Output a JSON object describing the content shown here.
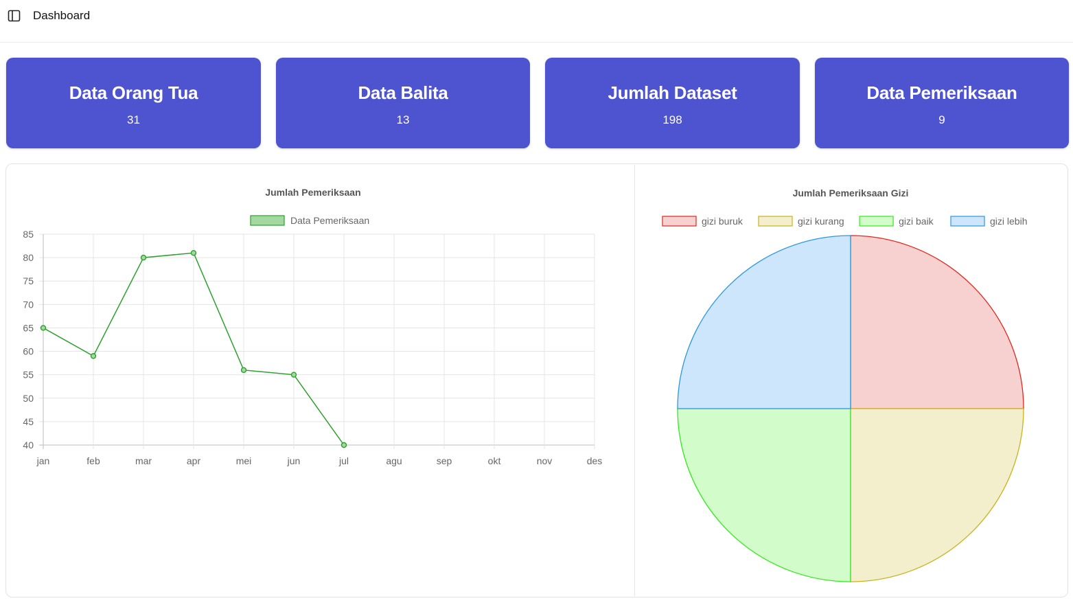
{
  "header": {
    "title": "Dashboard",
    "toggle_icon": "sidebar-toggle-icon"
  },
  "cards": [
    {
      "title": "Data Orang Tua",
      "value": "31"
    },
    {
      "title": "Data Balita",
      "value": "13"
    },
    {
      "title": "Jumlah Dataset",
      "value": "198"
    },
    {
      "title": "Data Pemeriksaan",
      "value": "9"
    }
  ],
  "colors": {
    "card_bg": "#4e54cf",
    "line": "#2ca02c",
    "line_fill": "#a3d8a0"
  },
  "chart_data": [
    {
      "type": "line",
      "title": "Jumlah Pemeriksaan",
      "categories": [
        "jan",
        "feb",
        "mar",
        "apr",
        "mei",
        "jun",
        "jul",
        "agu",
        "sep",
        "okt",
        "nov",
        "des"
      ],
      "series": [
        {
          "name": "Data Pemeriksaan",
          "values": [
            65,
            59,
            80,
            81,
            56,
            55,
            40,
            null,
            null,
            null,
            null,
            null
          ],
          "color": "#2ca02c"
        }
      ],
      "ylim": [
        40,
        85
      ],
      "yticks": [
        85,
        80,
        75,
        70,
        65,
        60,
        55,
        50,
        45,
        40
      ],
      "grid": true,
      "legend": "top-center"
    },
    {
      "type": "pie",
      "title": "Jumlah Pemeriksaan Gizi",
      "labels": [
        "gizi buruk",
        "gizi kurang",
        "gizi baik",
        "gizi lebih"
      ],
      "values": [
        25,
        25,
        25,
        25
      ],
      "colors": [
        {
          "border": "#e0261d",
          "fill": "#f7d1cf"
        },
        {
          "border": "#c9b21c",
          "fill": "#f3eecc"
        },
        {
          "border": "#34e81f",
          "fill": "#d2fdcb"
        },
        {
          "border": "#2a97e3",
          "fill": "#cde6fb"
        }
      ],
      "legend": "top-center"
    }
  ]
}
